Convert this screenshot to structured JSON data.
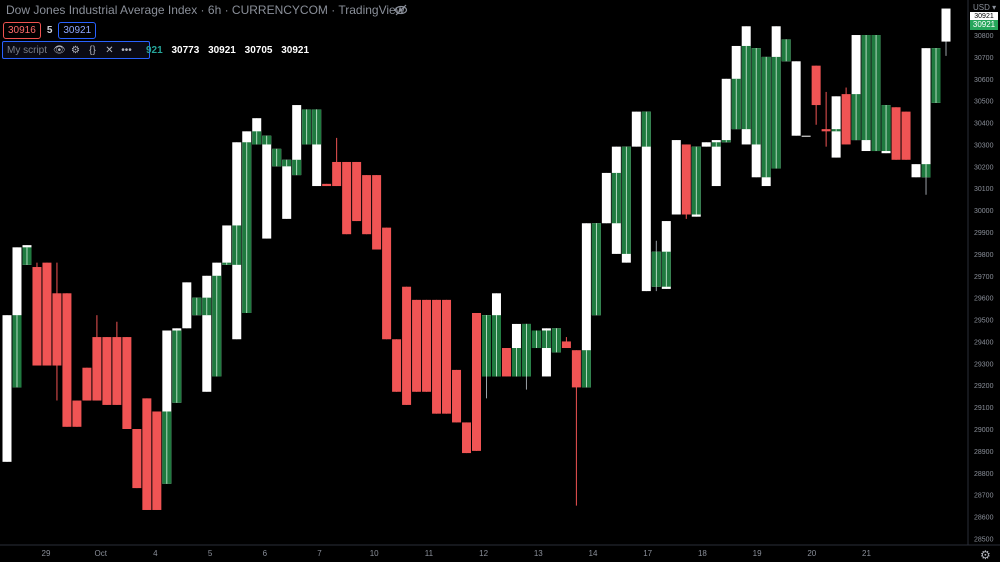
{
  "header": {
    "title": "Dow Jones Industrial Average Index · 6h · CURRENCYCOM · TradingView",
    "bid": "30916",
    "spread": "5",
    "ask": "30921",
    "script_label": "My script",
    "ohlc_partial": "921",
    "ohlc": [
      "30773",
      "30921",
      "30705",
      "30921"
    ]
  },
  "price_scale": {
    "currency": "USD",
    "last_price_label": "30921",
    "prev_price_label": "30921"
  },
  "icons": [
    "eye-off-icon",
    "eye-icon",
    "settings-icon",
    "source-code-icon",
    "close-icon",
    "more-icon",
    "gear-icon",
    "chevron-down-icon"
  ],
  "colors": {
    "background": "#000000",
    "up_candle": "#ffffff",
    "down_candle": "#f05454",
    "up_fill": "#1f7a3f",
    "axis_text": "#8a8f99",
    "last_price_bg": "#26a65b"
  },
  "chart_data": {
    "type": "bar",
    "title": "Dow Jones Industrial Average Index · 6h · CURRENCYCOM · TradingView",
    "x_tick_labels": [
      "29",
      "Oct",
      "4",
      "5",
      "6",
      "7",
      "10",
      "11",
      "12",
      "13",
      "14",
      "17",
      "18",
      "19",
      "20",
      "21"
    ],
    "y_ticks": [
      28500,
      28600,
      28700,
      28800,
      28900,
      29000,
      29100,
      29200,
      29300,
      29400,
      29500,
      29600,
      29700,
      29800,
      29900,
      30000,
      30100,
      30200,
      30300,
      30400,
      30500,
      30600,
      30700,
      30800
    ],
    "ylim": [
      28470,
      30960
    ],
    "grid": false,
    "candles": [
      {
        "open": 28850,
        "close": 29520,
        "high": 29520,
        "low": 28850
      },
      {
        "open": 29190,
        "close": 29830,
        "high": 29830,
        "low": 29190
      },
      {
        "open": 29750,
        "close": 29840,
        "high": 29840,
        "low": 29750
      },
      {
        "open": 29740,
        "close": 29290,
        "high": 29760,
        "low": 29290
      },
      {
        "open": 29760,
        "close": 29290,
        "high": 29760,
        "low": 29290
      },
      {
        "open": 29620,
        "close": 29290,
        "high": 29760,
        "low": 29130
      },
      {
        "open": 29620,
        "close": 29010,
        "high": 29620,
        "low": 29010
      },
      {
        "open": 29130,
        "close": 29010,
        "high": 29130,
        "low": 29010
      },
      {
        "open": 29280,
        "close": 29130,
        "high": 29280,
        "low": 29130
      },
      {
        "open": 29420,
        "close": 29130,
        "high": 29520,
        "low": 29130
      },
      {
        "open": 29420,
        "close": 29110,
        "high": 29420,
        "low": 29110
      },
      {
        "open": 29420,
        "close": 29110,
        "high": 29490,
        "low": 29110
      },
      {
        "open": 29420,
        "close": 29000,
        "high": 29420,
        "low": 29000
      },
      {
        "open": 29000,
        "close": 28730,
        "high": 29000,
        "low": 28730
      },
      {
        "open": 29140,
        "close": 28630,
        "high": 29140,
        "low": 28630
      },
      {
        "open": 29080,
        "close": 28630,
        "high": 29080,
        "low": 28630
      },
      {
        "open": 28750,
        "close": 29450,
        "high": 29450,
        "low": 28750
      },
      {
        "open": 29120,
        "close": 29460,
        "high": 29460,
        "low": 29120
      },
      {
        "open": 29460,
        "close": 29670,
        "high": 29670,
        "low": 29460
      },
      {
        "open": 29520,
        "close": 29600,
        "high": 29600,
        "low": 29520
      },
      {
        "open": 29170,
        "close": 29700,
        "high": 29700,
        "low": 29170
      },
      {
        "open": 29240,
        "close": 29760,
        "high": 29760,
        "low": 29240
      },
      {
        "open": 29750,
        "close": 29930,
        "high": 29930,
        "low": 29750
      },
      {
        "open": 29410,
        "close": 30310,
        "high": 30310,
        "low": 29410
      },
      {
        "open": 29530,
        "close": 30360,
        "high": 30360,
        "low": 29530
      },
      {
        "open": 30300,
        "close": 30420,
        "high": 30420,
        "low": 30300
      },
      {
        "open": 29870,
        "close": 30340,
        "high": 30340,
        "low": 29870
      },
      {
        "open": 30200,
        "close": 30280,
        "high": 30280,
        "low": 30200
      },
      {
        "open": 29960,
        "close": 30230,
        "high": 30230,
        "low": 29960
      },
      {
        "open": 30160,
        "close": 30480,
        "high": 30480,
        "low": 30160
      },
      {
        "open": 30300,
        "close": 30460,
        "high": 30460,
        "low": 30300
      },
      {
        "open": 30110,
        "close": 30460,
        "high": 30460,
        "low": 30110
      },
      {
        "open": 30120,
        "close": 30110,
        "high": 30120,
        "low": 30110
      },
      {
        "open": 30220,
        "close": 30110,
        "high": 30330,
        "low": 30110
      },
      {
        "open": 30220,
        "close": 29890,
        "high": 30220,
        "low": 29890
      },
      {
        "open": 30220,
        "close": 29950,
        "high": 30220,
        "low": 29950
      },
      {
        "open": 30160,
        "close": 29890,
        "high": 30160,
        "low": 29890
      },
      {
        "open": 30160,
        "close": 29820,
        "high": 30160,
        "low": 29820
      },
      {
        "open": 29920,
        "close": 29410,
        "high": 29920,
        "low": 29410
      },
      {
        "open": 29410,
        "close": 29170,
        "high": 29410,
        "low": 29170
      },
      {
        "open": 29650,
        "close": 29110,
        "high": 29650,
        "low": 29110
      },
      {
        "open": 29590,
        "close": 29170,
        "high": 29590,
        "low": 29170
      },
      {
        "open": 29590,
        "close": 29170,
        "high": 29590,
        "low": 29170
      },
      {
        "open": 29590,
        "close": 29070,
        "high": 29590,
        "low": 29070
      },
      {
        "open": 29590,
        "close": 29070,
        "high": 29590,
        "low": 29070
      },
      {
        "open": 29270,
        "close": 29030,
        "high": 29270,
        "low": 29030
      },
      {
        "open": 29030,
        "close": 28890,
        "high": 29030,
        "low": 28890
      },
      {
        "open": 29530,
        "close": 28900,
        "high": 29530,
        "low": 28900
      },
      {
        "open": 29240,
        "close": 29520,
        "high": 29520,
        "low": 29140
      },
      {
        "open": 29240,
        "close": 29620,
        "high": 29620,
        "low": 29240
      },
      {
        "open": 29370,
        "close": 29240,
        "high": 29370,
        "low": 29240
      },
      {
        "open": 29240,
        "close": 29480,
        "high": 29480,
        "low": 29240
      },
      {
        "open": 29240,
        "close": 29480,
        "high": 29480,
        "low": 29180
      },
      {
        "open": 29370,
        "close": 29450,
        "high": 29450,
        "low": 29370
      },
      {
        "open": 29240,
        "close": 29460,
        "high": 29460,
        "low": 29240
      },
      {
        "open": 29350,
        "close": 29460,
        "high": 29460,
        "low": 29350
      },
      {
        "open": 29400,
        "close": 29370,
        "high": 29420,
        "low": 29370
      },
      {
        "open": 29360,
        "close": 29190,
        "high": 29360,
        "low": 28650
      },
      {
        "open": 29190,
        "close": 29940,
        "high": 29940,
        "low": 29190
      },
      {
        "open": 29520,
        "close": 29940,
        "high": 29940,
        "low": 29520
      },
      {
        "open": 29940,
        "close": 30170,
        "high": 30170,
        "low": 29940
      },
      {
        "open": 29800,
        "close": 30290,
        "high": 30290,
        "low": 29800
      },
      {
        "open": 29760,
        "close": 30290,
        "high": 30290,
        "low": 29760
      },
      {
        "open": 30290,
        "close": 30450,
        "high": 30450,
        "low": 30290
      },
      {
        "open": 29630,
        "close": 30450,
        "high": 30450,
        "low": 29630
      },
      {
        "open": 29650,
        "close": 29810,
        "high": 29860,
        "low": 29630
      },
      {
        "open": 29640,
        "close": 29950,
        "high": 29950,
        "low": 29640
      },
      {
        "open": 29980,
        "close": 30320,
        "high": 30320,
        "low": 29980
      },
      {
        "open": 30300,
        "close": 29980,
        "high": 30300,
        "low": 29960
      },
      {
        "open": 29970,
        "close": 30290,
        "high": 30290,
        "low": 29970
      },
      {
        "open": 30290,
        "close": 30310,
        "high": 30310,
        "low": 30290
      },
      {
        "open": 30110,
        "close": 30320,
        "high": 30320,
        "low": 30110
      },
      {
        "open": 30310,
        "close": 30600,
        "high": 30600,
        "low": 30310
      },
      {
        "open": 30370,
        "close": 30750,
        "high": 30750,
        "low": 30370
      },
      {
        "open": 30300,
        "close": 30840,
        "high": 30840,
        "low": 30300
      },
      {
        "open": 30150,
        "close": 30740,
        "high": 30740,
        "low": 30150
      },
      {
        "open": 30110,
        "close": 30700,
        "high": 30700,
        "low": 30110
      },
      {
        "open": 30190,
        "close": 30840,
        "high": 30840,
        "low": 30190
      },
      {
        "open": 30680,
        "close": 30780,
        "high": 30780,
        "low": 30680
      },
      {
        "open": 30340,
        "close": 30680,
        "high": 30680,
        "low": 30340
      },
      {
        "open": 30340,
        "close": 30340,
        "high": 30340,
        "low": 30340
      },
      {
        "open": 30660,
        "close": 30480,
        "high": 30660,
        "low": 30390
      },
      {
        "open": 30370,
        "close": 30360,
        "high": 30540,
        "low": 30290
      },
      {
        "open": 30240,
        "close": 30520,
        "high": 30520,
        "low": 30240
      },
      {
        "open": 30530,
        "close": 30300,
        "high": 30560,
        "low": 30300
      },
      {
        "open": 30320,
        "close": 30800,
        "high": 30800,
        "low": 30320
      },
      {
        "open": 30270,
        "close": 30800,
        "high": 30800,
        "low": 30270
      },
      {
        "open": 30270,
        "close": 30800,
        "high": 30800,
        "low": 30270
      },
      {
        "open": 30260,
        "close": 30480,
        "high": 30480,
        "low": 30260
      },
      {
        "open": 30470,
        "close": 30230,
        "high": 30470,
        "low": 30230
      },
      {
        "open": 30450,
        "close": 30230,
        "high": 30450,
        "low": 30230
      },
      {
        "open": 30150,
        "close": 30210,
        "high": 30210,
        "low": 30150
      },
      {
        "open": 30150,
        "close": 30740,
        "high": 30740,
        "low": 30070
      },
      {
        "open": 30490,
        "close": 30740,
        "high": 30740,
        "low": 30490
      },
      {
        "open": 30770,
        "close": 30921,
        "high": 30921,
        "low": 30705
      }
    ]
  }
}
